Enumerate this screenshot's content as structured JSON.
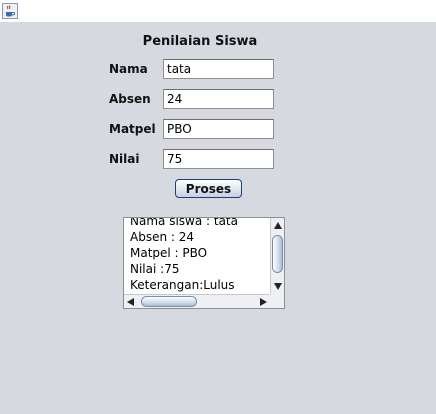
{
  "window": {
    "icon": "java-cup-icon"
  },
  "form": {
    "title": "Penilaian Siswa",
    "fields": [
      {
        "label": "Nama",
        "value": "tata"
      },
      {
        "label": "Absen",
        "value": "24"
      },
      {
        "label": "Matpel",
        "value": "PBO"
      },
      {
        "label": "Nilai",
        "value": "75"
      }
    ],
    "button_label": "Proses"
  },
  "output": {
    "lines": [
      "Nama siswa : tata",
      "Absen : 24",
      "Matpel : PBO",
      "Nilai :75",
      "Keterangan:Lulus"
    ]
  },
  "colors": {
    "panel_bg": "#d6d9df",
    "button_border": "#1d3f78"
  }
}
